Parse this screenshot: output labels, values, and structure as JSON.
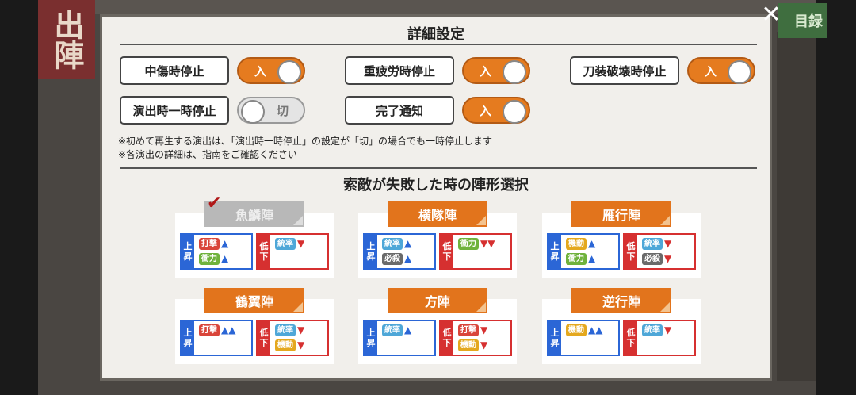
{
  "background": {
    "banner": "出陣",
    "catalog_button": "目録"
  },
  "close_icon": "✕",
  "dialog": {
    "title": "詳細設定",
    "settings": [
      {
        "label": "中傷時停止",
        "state": "入",
        "on": true
      },
      {
        "label": "重疲労時停止",
        "state": "入",
        "on": true
      },
      {
        "label": "刀装破壊時停止",
        "state": "入",
        "on": true
      },
      {
        "label": "演出時一時停止",
        "state": "切",
        "on": false
      },
      {
        "label": "完了通知",
        "state": "入",
        "on": true
      }
    ],
    "notes": [
      "※初めて再生する演出は、「演出時一時停止」の設定が「切」の場合でも一時停止します",
      "※各演出の詳細は、指南をご確認ください"
    ],
    "formation_title": "索敵が失敗した時の陣形選択",
    "up_label": [
      "上",
      "昇"
    ],
    "down_label": [
      "低",
      "下"
    ],
    "check_icon": "✔",
    "formations": [
      {
        "name": "魚鱗陣",
        "selected": true,
        "up": [
          {
            "stat": "打撃",
            "color": "#d9453a",
            "arrows": "▲"
          },
          {
            "stat": "衝力",
            "color": "#6fb23c",
            "arrows": "▲"
          }
        ],
        "down": [
          {
            "stat": "統率",
            "color": "#4ea7d8",
            "arrows": "▼"
          }
        ]
      },
      {
        "name": "横隊陣",
        "selected": false,
        "up": [
          {
            "stat": "統率",
            "color": "#4ea7d8",
            "arrows": "▲"
          },
          {
            "stat": "必殺",
            "color": "#6a6a6a",
            "arrows": "▲"
          }
        ],
        "down": [
          {
            "stat": "衝力",
            "color": "#6fb23c",
            "arrows": "▼▼"
          }
        ]
      },
      {
        "name": "雁行陣",
        "selected": false,
        "up": [
          {
            "stat": "機動",
            "color": "#e4a81e",
            "arrows": "▲"
          },
          {
            "stat": "衝力",
            "color": "#6fb23c",
            "arrows": "▲"
          }
        ],
        "down": [
          {
            "stat": "統率",
            "color": "#4ea7d8",
            "arrows": "▼"
          },
          {
            "stat": "必殺",
            "color": "#6a6a6a",
            "arrows": "▼"
          }
        ]
      },
      {
        "name": "鶴翼陣",
        "selected": false,
        "up": [
          {
            "stat": "打撃",
            "color": "#d9453a",
            "arrows": "▲▲"
          }
        ],
        "down": [
          {
            "stat": "統率",
            "color": "#4ea7d8",
            "arrows": "▼"
          },
          {
            "stat": "機動",
            "color": "#e4a81e",
            "arrows": "▼"
          }
        ]
      },
      {
        "name": "方陣",
        "selected": false,
        "up": [
          {
            "stat": "統率",
            "color": "#4ea7d8",
            "arrows": "▲"
          }
        ],
        "down": [
          {
            "stat": "打撃",
            "color": "#d9453a",
            "arrows": "▼"
          },
          {
            "stat": "機動",
            "color": "#e4a81e",
            "arrows": "▼"
          }
        ]
      },
      {
        "name": "逆行陣",
        "selected": false,
        "up": [
          {
            "stat": "機動",
            "color": "#e4a81e",
            "arrows": "▲▲"
          }
        ],
        "down": [
          {
            "stat": "統率",
            "color": "#4ea7d8",
            "arrows": "▼"
          }
        ]
      }
    ]
  }
}
